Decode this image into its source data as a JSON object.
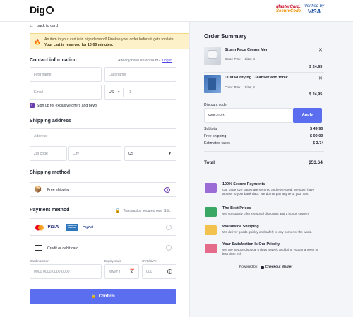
{
  "header": {
    "logo": "Dig",
    "mastercard_line1": "MasterCard.",
    "mastercard_line2": "SecureCode",
    "visa_line1": "Verified by",
    "visa_line2": "VISA"
  },
  "nav": {
    "back_label": "back to card"
  },
  "alert": {
    "line1": "An item in your cart is in high demand! Finalise your order before it gets too late.",
    "line2": "Your cart is reserved for 10:00 minutes."
  },
  "contact": {
    "title": "Contact information",
    "account_prompt": "Already have an account?",
    "login_label": "Log in",
    "first_name_placeholder": "First name",
    "last_name_placeholder": "Last name",
    "email_placeholder": "Email",
    "country_code": "US",
    "phone_prefix": "+1",
    "signup_label": "Sign up for exclusive offers and news"
  },
  "shipping": {
    "title": "Shipping address",
    "address_placeholder": "Address",
    "zip_placeholder": "Zip code",
    "city_placeholder": "City",
    "country_value": "US"
  },
  "shipping_method": {
    "title": "Shipping method",
    "option_label": "Free shipping"
  },
  "payment": {
    "title": "Payment method",
    "secure_note": "Transaction secured over SSL",
    "card_brands": [
      "VISA",
      "AMERICAN EXPRESS",
      "PayPal"
    ],
    "card_option_label": "Credit or debit card",
    "card_number_label": "Card number",
    "card_number_placeholder": "0000 0000 0000 0000",
    "expiry_label": "Expiry code",
    "expiry_placeholder": "MM/YY",
    "cvc_label": "CVC/CVV",
    "cvc_placeholder": "000",
    "confirm_label": "Confirm"
  },
  "summary": {
    "title": "Order Summary",
    "items": [
      {
        "name": "Sturm Face Cream Men",
        "color": "Color: Pink",
        "size": "Size; S",
        "price": "$ 24,95"
      },
      {
        "name": "Dust Purifying Cleanser and tonic",
        "color": "Color: Pink",
        "size": "Size; S",
        "price": "$ 24,95"
      }
    ],
    "discount_label": "Discount code",
    "discount_value": "WIN2023",
    "apply_label": "Apply",
    "subtotal_label": "Subtotal",
    "subtotal_value": "$ 49,90",
    "free_shipping_label": "Free shipping",
    "free_shipping_value": "$ 00,00",
    "taxes_label": "Estimated taxes",
    "taxes_value": "$ 3.74",
    "total_label": "Total",
    "total_value": "$53.64"
  },
  "features": [
    {
      "title": "100% Secure Payments",
      "desc": "Our page size pages are secured and encrypted. We don't have access to your bank data. We do not pay any re ut your cart."
    },
    {
      "title": "The Best Prices",
      "desc": "We constantly offer seasonal discounts and a bonus system."
    },
    {
      "title": "Worldwide Shipping",
      "desc": "We deliver goods quickly and safely to any corner of the world."
    },
    {
      "title": "Your Satisfaction Is Our Priority",
      "desc": "We are at your disposal 6 days a week and bring you an answer in less than 24h"
    }
  ],
  "powered": {
    "prefix": "Powered by:",
    "brand": "Checkout Master"
  },
  "colors": {
    "accent": "#5b6ef0",
    "purple": "#6b3fb0",
    "alert_bg": "#fdf1c9"
  }
}
